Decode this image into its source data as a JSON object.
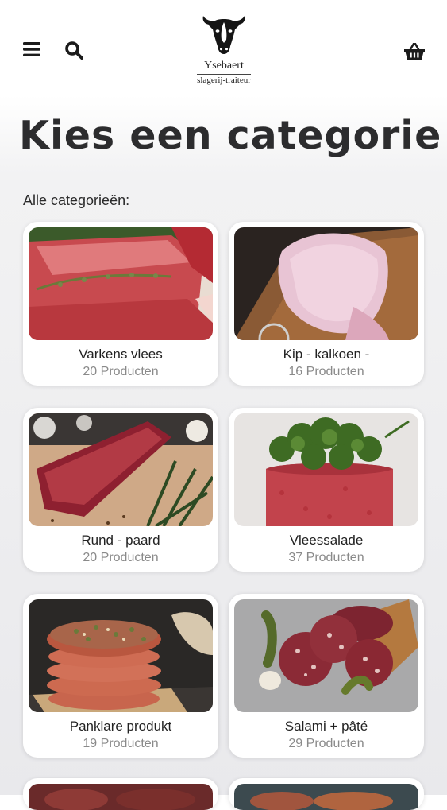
{
  "header": {
    "brand_name": "Ysebaert",
    "brand_sub": "slagerij-traiteur"
  },
  "page": {
    "title": "Kies een categorie",
    "subtitle": "Alle categorieën:"
  },
  "categories": [
    {
      "title": "Varkens vlees",
      "count": "20 Producten"
    },
    {
      "title": "Kip - kalkoen -",
      "count": "16 Producten"
    },
    {
      "title": "Rund - paard",
      "count": "20 Producten"
    },
    {
      "title": "Vleessalade",
      "count": "37 Producten"
    },
    {
      "title": "Panklare produkt",
      "count": "19 Producten"
    },
    {
      "title": "Salami + pâté",
      "count": "29 Producten"
    }
  ],
  "colors": {
    "text_dark": "#2c2c2e",
    "muted": "#8a8a8a",
    "card_bg": "#ffffff"
  }
}
